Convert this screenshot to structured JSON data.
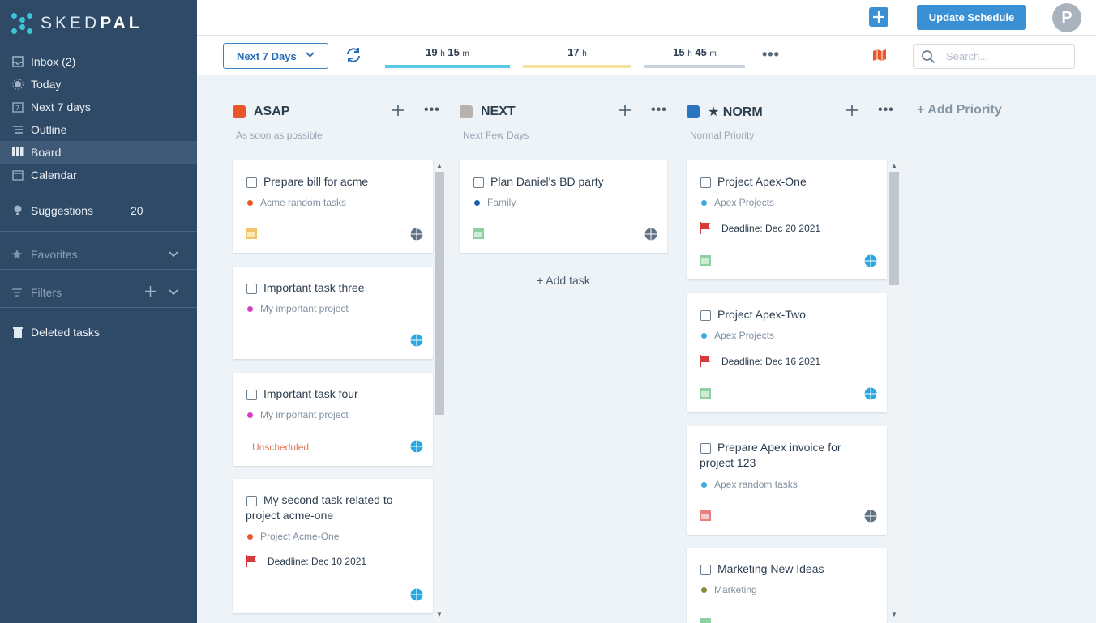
{
  "app": {
    "logo_text_a": "SKED",
    "logo_text_b": "PAL"
  },
  "sidebar": {
    "items": [
      {
        "label": "Inbox (2)",
        "icon": "inbox-icon"
      },
      {
        "label": "Today",
        "icon": "sun-icon"
      },
      {
        "label": "Next 7 days",
        "icon": "calendar-7-icon"
      },
      {
        "label": "Outline",
        "icon": "outline-icon"
      },
      {
        "label": "Board",
        "icon": "board-icon",
        "active": true
      },
      {
        "label": "Calendar",
        "icon": "calendar-icon"
      }
    ],
    "suggestions": {
      "label": "Suggestions",
      "count": "20"
    },
    "favorites": "Favorites",
    "filters": "Filters",
    "deleted": "Deleted tasks"
  },
  "header": {
    "update_label": "Update Schedule",
    "avatar_letter": "P"
  },
  "toolbar": {
    "range_label": "Next 7 Days",
    "timers": [
      {
        "h": "19",
        "m": "15",
        "color": "#5bc8e6"
      },
      {
        "h": "17",
        "m": "",
        "color": "#f7e3a0"
      },
      {
        "h": "15",
        "m": "45",
        "color": "#c9d3de"
      }
    ],
    "unit_h": "h",
    "unit_m": "m",
    "search_placeholder": "Search..."
  },
  "add_priority": "+ Add Priority",
  "add_task": "+ Add task",
  "columns": [
    {
      "title": "ASAP",
      "subtitle": "As soon as possible",
      "color": "#e8562a",
      "cards": [
        {
          "title": "Prepare bill for acme",
          "project": "Acme random tasks",
          "dot": "#e8562a",
          "cal": "#f2c46a"
        },
        {
          "title": "Important task three",
          "project": "My important project",
          "dot": "#d63cc4"
        },
        {
          "title": "Important task four",
          "project": "My important project",
          "dot": "#d63cc4",
          "unscheduled": "Unscheduled"
        },
        {
          "title": "My second task related to project acme-one",
          "project": "Project Acme-One",
          "dot": "#e8562a",
          "deadline": "Deadline: Dec 10 2021"
        }
      ]
    },
    {
      "title": "NEXT",
      "subtitle": "Next Few Days",
      "color": "#b7b2ac",
      "cards": [
        {
          "title": "Plan Daniel's BD party",
          "project": "Family",
          "dot": "#1f5fa8",
          "cal": "#8fd0a0"
        }
      ]
    },
    {
      "title": "★ NORM",
      "subtitle": "Normal Priority",
      "color": "#2a74c0",
      "cards": [
        {
          "title": "Project Apex-One",
          "project": "Apex Projects",
          "dot": "#3aaee0",
          "deadline": "Deadline: Dec 20 2021"
        },
        {
          "title": "Project Apex-Two",
          "project": "Apex Projects",
          "dot": "#3aaee0",
          "deadline": "Deadline: Dec 16 2021"
        },
        {
          "title": "Prepare Apex invoice for project 123",
          "project": "Apex random tasks",
          "dot": "#3aaee0"
        },
        {
          "title": "Marketing New Ideas",
          "project": "Marketing",
          "dot": "#8a8a3a"
        }
      ]
    }
  ]
}
